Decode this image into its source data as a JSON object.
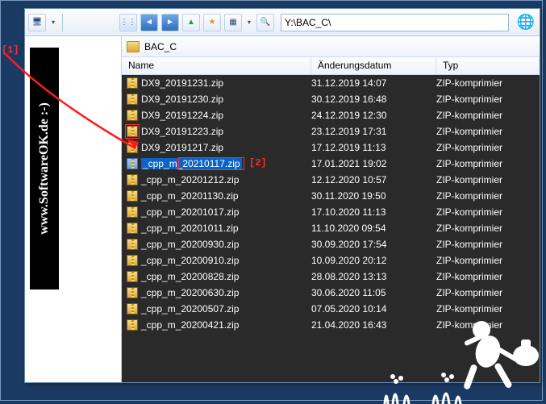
{
  "path": "Y:\\BAC_C\\",
  "crumb_folder": "BAC_C",
  "ad_text": "www.SoftwareOK.de :-)",
  "annotations": {
    "a1": "[1]",
    "a2": "[2]"
  },
  "columns": {
    "name": "Name",
    "date": "Änderungsdatum",
    "type": "Typ"
  },
  "files": [
    {
      "name": "DX9_20191231.zip",
      "date": "31.12.2019 14:07",
      "type": "ZIP-komprimier"
    },
    {
      "name": "DX9_20191230.zip",
      "date": "30.12.2019 16:48",
      "type": "ZIP-komprimier"
    },
    {
      "name": "DX9_20191224.zip",
      "date": "24.12.2019 12:30",
      "type": "ZIP-komprimier"
    },
    {
      "name": "DX9_20191223.zip",
      "date": "23.12.2019 17:31",
      "type": "ZIP-komprimier"
    },
    {
      "name": "DX9_20191217.zip",
      "date": "17.12.2019 11:13",
      "type": "ZIP-komprimier"
    },
    {
      "name": "_cpp_m_20210117.zip",
      "date": "17.01.2021 19:02",
      "type": "ZIP-komprimier",
      "selected": true
    },
    {
      "name": "_cpp_m_20201212.zip",
      "date": "12.12.2020 10:57",
      "type": "ZIP-komprimier"
    },
    {
      "name": "_cpp_m_20201130.zip",
      "date": "30.11.2020 19:50",
      "type": "ZIP-komprimier"
    },
    {
      "name": "_cpp_m_20201017.zip",
      "date": "17.10.2020 11:13",
      "type": "ZIP-komprimier"
    },
    {
      "name": "_cpp_m_20201011.zip",
      "date": "11.10.2020 09:54",
      "type": "ZIP-komprimier"
    },
    {
      "name": "_cpp_m_20200930.zip",
      "date": "30.09.2020 17:54",
      "type": "ZIP-komprimier"
    },
    {
      "name": "_cpp_m_20200910.zip",
      "date": "10.09.2020 20:12",
      "type": "ZIP-komprimier"
    },
    {
      "name": "_cpp_m_20200828.zip",
      "date": "28.08.2020 13:13",
      "type": "ZIP-komprimier"
    },
    {
      "name": "_cpp_m_20200630.zip",
      "date": "30.06.2020 11:05",
      "type": "ZIP-komprimier"
    },
    {
      "name": "_cpp_m_20200507.zip",
      "date": "07.05.2020 10:14",
      "type": "ZIP-komprimier"
    },
    {
      "name": "_cpp_m_20200421.zip",
      "date": "21.04.2020 16:43",
      "type": "ZIP-komprimier"
    }
  ],
  "toolbar": {
    "monitor": "🖥",
    "back": "◄",
    "fwd": "►",
    "up": "▲",
    "search": "🔍",
    "views": "▦",
    "apps": "⋮⋮",
    "menu": "▾"
  }
}
